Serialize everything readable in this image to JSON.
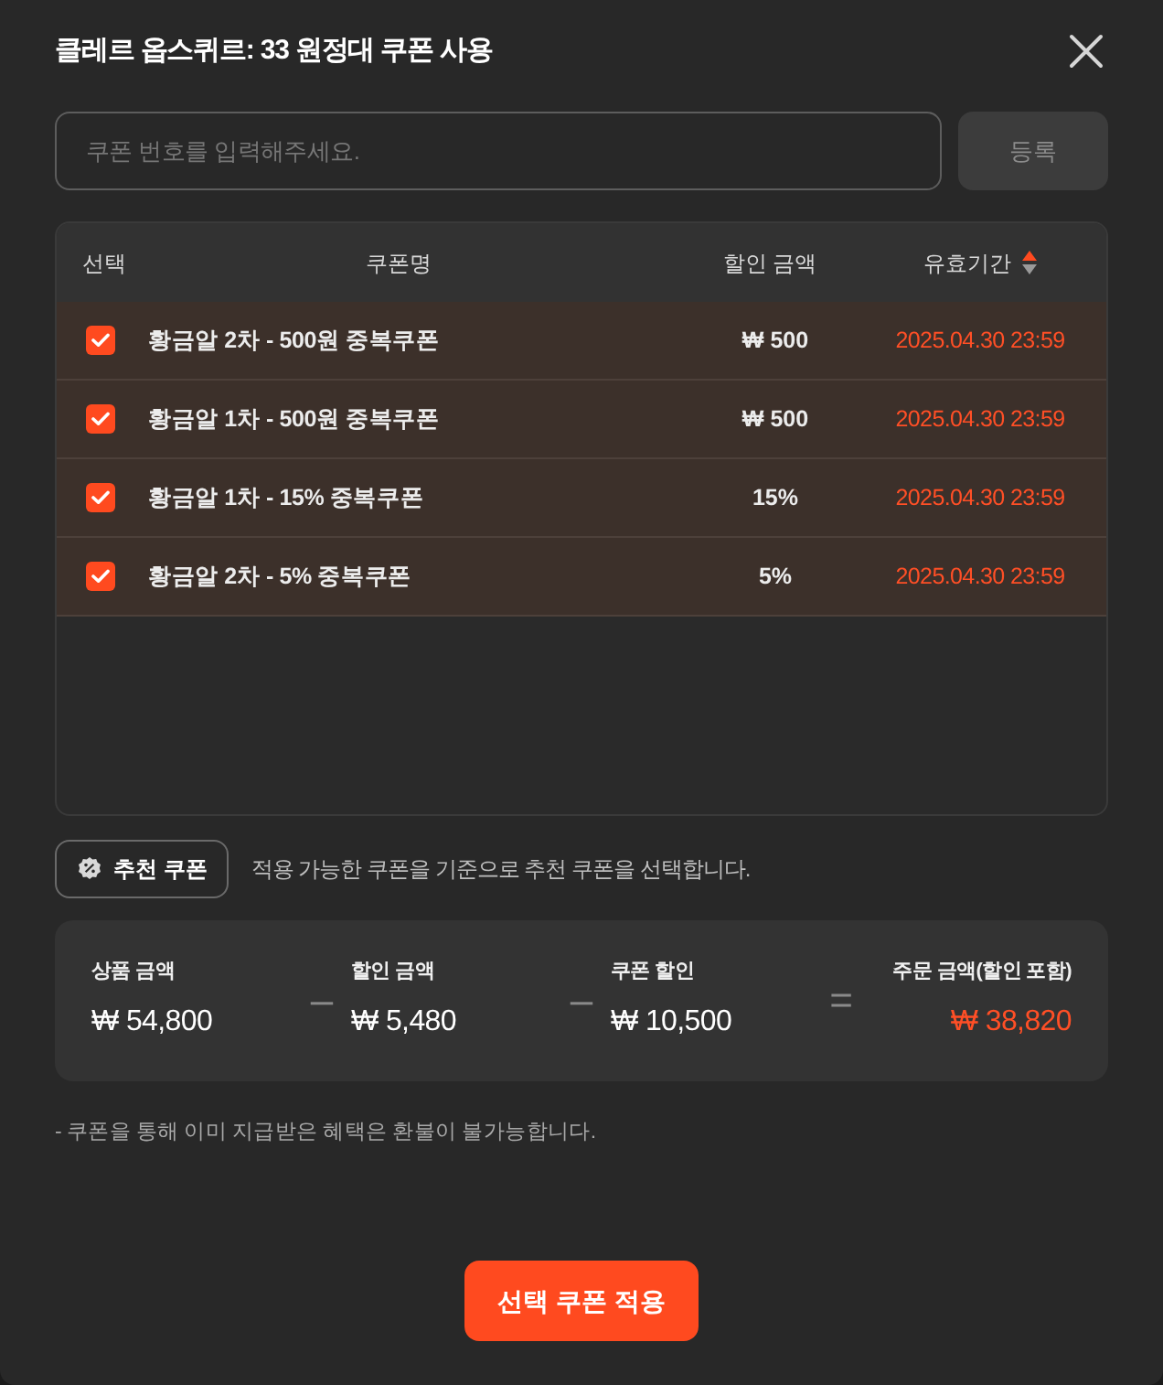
{
  "dialog": {
    "title": "클레르 옵스퀴르: 33 원정대 쿠폰 사용"
  },
  "coupon_input": {
    "placeholder": "쿠폰 번호를 입력해주세요.",
    "button": "등록"
  },
  "table": {
    "columns": [
      {
        "label": "선택"
      },
      {
        "label": "쿠폰명"
      },
      {
        "label": "할인 금액"
      },
      {
        "label": "유효기간",
        "sorted_ascending": true
      }
    ],
    "rows": [
      {
        "checked": true,
        "name": "황금알 2차 - 500원 중복쿠폰",
        "discount": "₩ 500",
        "expires": "2025.04.30 23:59"
      },
      {
        "checked": true,
        "name": "황금알 1차 - 500원 중복쿠폰",
        "discount": "₩ 500",
        "expires": "2025.04.30 23:59"
      },
      {
        "checked": true,
        "name": "황금알 1차 - 15% 중복쿠폰",
        "discount": "15%",
        "expires": "2025.04.30 23:59"
      },
      {
        "checked": true,
        "name": "황금알 2차 - 5% 중복쿠폰",
        "discount": "5%",
        "expires": "2025.04.30 23:59"
      }
    ]
  },
  "recommend": {
    "button": "추천 쿠폰",
    "description": "적용 가능한 쿠폰을 기준으로 추천 쿠폰을 선택합니다."
  },
  "summary": [
    {
      "kind": "amount",
      "label": "상품 금액",
      "value": "₩ 54,800"
    },
    {
      "kind": "operator",
      "symbol": "–"
    },
    {
      "kind": "amount",
      "label": "할인 금액",
      "value": "₩ 5,480"
    },
    {
      "kind": "operator",
      "symbol": "–"
    },
    {
      "kind": "amount",
      "label": "쿠폰 할인",
      "value": "₩ 10,500"
    },
    {
      "kind": "operator",
      "symbol": "="
    },
    {
      "kind": "total",
      "label": "주문 금액(할인 포함)",
      "value": "₩ 38,820"
    }
  ],
  "note": "- 쿠폰을 통해 이미 지급받은 혜택은 환불이 불가능합니다.",
  "apply_button": "선택 쿠폰 적용"
}
